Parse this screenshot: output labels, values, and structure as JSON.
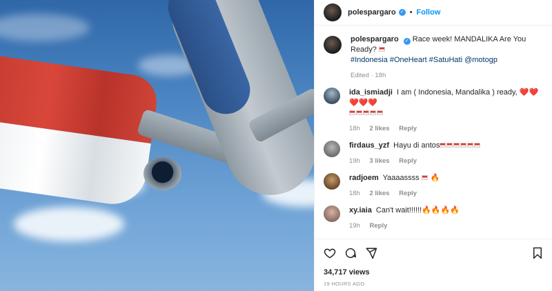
{
  "header": {
    "username": "polespargaro",
    "dot": "•",
    "follow_label": "Follow"
  },
  "caption": {
    "username": "polespargaro",
    "text": "Race week! MANDALIKA Are You Ready?",
    "tags": "#Indonesia #OneHeart #SatuHati @motogp",
    "edited": "Edited · 18h"
  },
  "comments": [
    {
      "username": "ida_ismiadji",
      "text": "I am ( Indonesia, Mandalika ) ready,",
      "hearts": "❤️❤️❤️❤️❤️",
      "time": "18h",
      "likes": "2 likes",
      "reply": "Reply"
    },
    {
      "username": "firdaus_yzf",
      "text": "Hayu di antos",
      "time": "19h",
      "likes": "3 likes",
      "reply": "Reply"
    },
    {
      "username": "radjoem",
      "text": "Yaaaassss",
      "fire": "🔥",
      "time": "18h",
      "likes": "2 likes",
      "reply": "Reply"
    },
    {
      "username": "xy.iaia",
      "text": "Can't wait!!!!!!",
      "fire": "🔥🔥🔥🔥",
      "time": "19h",
      "reply": "Reply"
    }
  ],
  "stats": {
    "views": "34,717 views",
    "posted": "19 HOURS AGO"
  },
  "icons": [
    "heart-icon",
    "comment-icon",
    "share-icon",
    "bookmark-icon",
    "verified-badge-icon"
  ],
  "colors": {
    "link": "#00376b",
    "follow": "#0095f6",
    "verified": "#3897f0",
    "muted": "#8e8e8e"
  }
}
